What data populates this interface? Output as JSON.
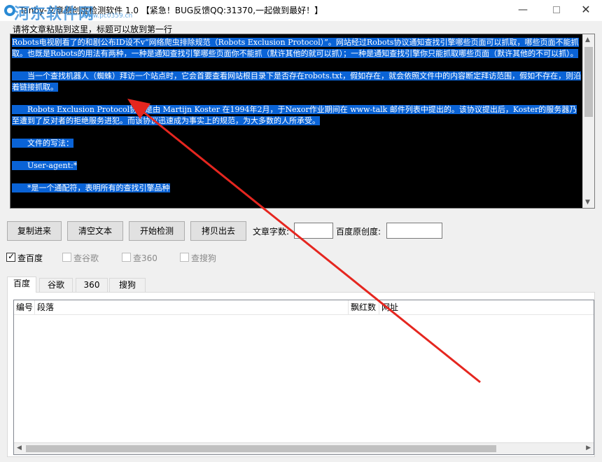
{
  "window": {
    "title": "Tanby-文章原创度检测软件 1.0 【紧急！BUG反馈QQ:31370,一起做到最好！】",
    "watermark": "河东软件网",
    "watermark_url": "www.pc0359.cn",
    "minimize_icon": "minimize-icon",
    "maximize_icon": "maximize-icon",
    "close_icon": "close-icon"
  },
  "editor": {
    "hint": "请将文章粘贴到这里，标题可以放到第一行",
    "paragraphs": [
      "Robots电视剧看了的和剧公布ID设不v“网络爬虫排除规范（Robots Exclusion Protocol）”。网站经过Robots协议通知查找引擎哪些页面可以抓取，哪些页面不能抓取。也既是Robots的用法有两种，一种是通知查找引擎哪些页面你不能抓（默许其他的就可以抓）；一种是通知查找引擎你只能抓取哪些页面（默许其他的不可以抓）。",
      "　　当一个查找机器人（蜘蛛）拜访一个站点时，它会首要查看网站根目录下是否存在robots.txt，假如存在，就会依照文件中的内容断定拜访范围，假如不存在，则沿着链接抓取。",
      "　　Robots Exclusion Protocol协议是由 Martijn Koster 在1994年2月，于Nexor作业期间在 www-talk 邮件列表中提出的。该协议提出后，Koster的服务器乃至遭到了反对者的拒绝服务进犯。而该协议迅速成为事实上的规范，为大多数的人所承受。",
      "　　文件的写法：",
      "　　User-agent:*",
      "　　*是一个通配符，表明所有的查找引擎品种"
    ]
  },
  "toolbar": {
    "copy_in": "复制进来",
    "clear_text": "清空文本",
    "start_check": "开始检测",
    "copy_out": "拷贝出去",
    "word_count_label": "文章字数:",
    "word_count_value": "",
    "originality_label": "百度原创度:",
    "originality_value": ""
  },
  "options": [
    {
      "label": "查百度",
      "checked": true,
      "enabled": true
    },
    {
      "label": "查谷歌",
      "checked": false,
      "enabled": false
    },
    {
      "label": "查360",
      "checked": false,
      "enabled": false
    },
    {
      "label": "查搜狗",
      "checked": false,
      "enabled": false
    }
  ],
  "tabs": [
    "百度",
    "谷歌",
    "360",
    "搜狗"
  ],
  "active_tab": "百度",
  "table": {
    "columns": [
      "编号",
      "段落",
      "飘红数",
      "网址"
    ],
    "rows": []
  },
  "colors": {
    "editor_bg": "#000000",
    "selection": "#0a63d6",
    "annotation_arrow": "#e5261f",
    "watermark": "#2a86d8"
  }
}
